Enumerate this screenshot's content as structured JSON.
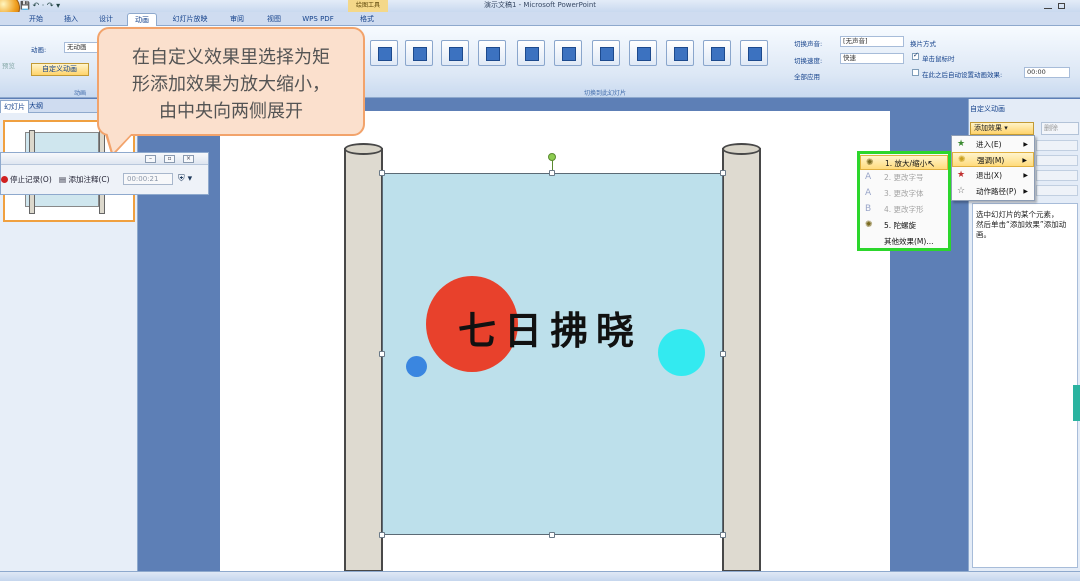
{
  "window": {
    "title": "演示文稿1 - Microsoft PowerPoint",
    "context_tab": "绘图工具"
  },
  "tabs": [
    {
      "label": "开始"
    },
    {
      "label": "插入"
    },
    {
      "label": "设计"
    },
    {
      "label": "动画"
    },
    {
      "label": "幻灯片放映"
    },
    {
      "label": "审阅"
    },
    {
      "label": "视图"
    },
    {
      "label": "WPS PDF"
    },
    {
      "label": "格式"
    }
  ],
  "ribbon": {
    "preview_label": "预览",
    "animation_label": "动画:",
    "animation_value": "无动画",
    "custom_anim_button": "自定义动画",
    "group_anim": "动画",
    "group_transition": "切换到此幻灯片",
    "sound_label": "切换声音:",
    "sound_value": "[无声音]",
    "speed_label": "切换速度:",
    "speed_value": "快速",
    "apply_all": "全部应用",
    "advance_title": "换片方式",
    "on_click": "单击鼠标时",
    "auto_after": "在此之后自动设置动画效果:",
    "auto_time": "00:00"
  },
  "callout": {
    "line1": "在自定义效果里选择为矩",
    "line2": "形添加效果为放大缩小，",
    "line3": "由中央向两侧展开"
  },
  "left_panel": {
    "tab_slides": "幻灯片",
    "tab_outline": "大纲",
    "close": "×"
  },
  "recorder": {
    "stop": "停止记录(O)",
    "annotate": "添加注释(C)",
    "time": "00:00:21"
  },
  "slide": {
    "text": "七日拂晓"
  },
  "custom_animation": {
    "title": "自定义动画",
    "add_effect": "添加效果 ▾",
    "remove": "删除",
    "hint_line1": "选中幻灯片的某个元素，",
    "hint_line2": "然后单击“添加效果”添加动画。"
  },
  "menu_add_effect": [
    {
      "label": "进入(E)",
      "icon": "entrance-star-icon"
    },
    {
      "label": "强调(M)",
      "icon": "emphasis-star-icon"
    },
    {
      "label": "退出(X)",
      "icon": "exit-star-icon"
    },
    {
      "label": "动作路径(P)",
      "icon": "path-star-icon"
    }
  ],
  "menu_emphasis": [
    {
      "label": "1. 放大/缩小",
      "enabled": true
    },
    {
      "label": "2. 更改字号",
      "enabled": false
    },
    {
      "label": "3. 更改字体",
      "enabled": false
    },
    {
      "label": "4. 更改字形",
      "enabled": false
    },
    {
      "label": "5. 陀螺旋",
      "enabled": true
    },
    {
      "label": "其他效果(M)...",
      "enabled": true
    }
  ],
  "colors": {
    "highlight_frame": "#2cd62c",
    "callout_border": "#f2a36b",
    "callout_fill": "#fbe0cd",
    "red_circle": "#e8412c",
    "cyan_circle": "#33eaf0",
    "blue_dot": "#3a86e0",
    "scroll_panel": "#bde0eb"
  }
}
